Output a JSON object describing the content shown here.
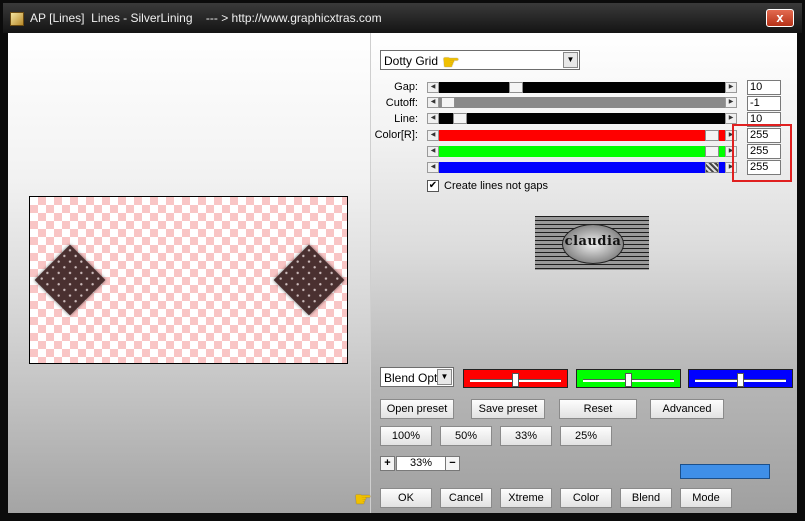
{
  "window": {
    "title": "AP [Lines]  Lines - SilverLining    --- > http://www.graphicxtras.com",
    "close_label": "x"
  },
  "controls": {
    "pattern_select": "Dotty Grid",
    "rows": [
      {
        "label": "Gap:",
        "value": "10"
      },
      {
        "label": "Cutoff:",
        "value": "-1"
      },
      {
        "label": "Line:",
        "value": "10"
      },
      {
        "label": "Color[R]:",
        "value": "255"
      },
      {
        "label": "",
        "value": "255"
      },
      {
        "label": "",
        "value": "255"
      }
    ],
    "checkbox_label": "Create lines not gaps",
    "checkbox_mark": "✔"
  },
  "logo_text": "claudia",
  "blend": {
    "select": "Blend Options"
  },
  "buttons": {
    "open_preset": "Open preset",
    "save_preset": "Save preset",
    "reset": "Reset",
    "advanced": "Advanced",
    "zoom100": "100%",
    "zoom50": "50%",
    "zoom33": "33%",
    "zoom25": "25%",
    "plus": "+",
    "minus": "−",
    "ok": "OK",
    "cancel": "Cancel",
    "xtreme": "Xtreme",
    "color": "Color",
    "blend": "Blend",
    "mode": "Mode"
  },
  "zoom_value": "33%",
  "colors": {
    "red_channel": "#ff0000",
    "green_channel": "#00ff00",
    "blue_channel": "#0000ff",
    "highlight": "#e02020",
    "swatch": "#3f8fe8"
  },
  "icons": {
    "pointer": "hand-pointer-icon"
  }
}
